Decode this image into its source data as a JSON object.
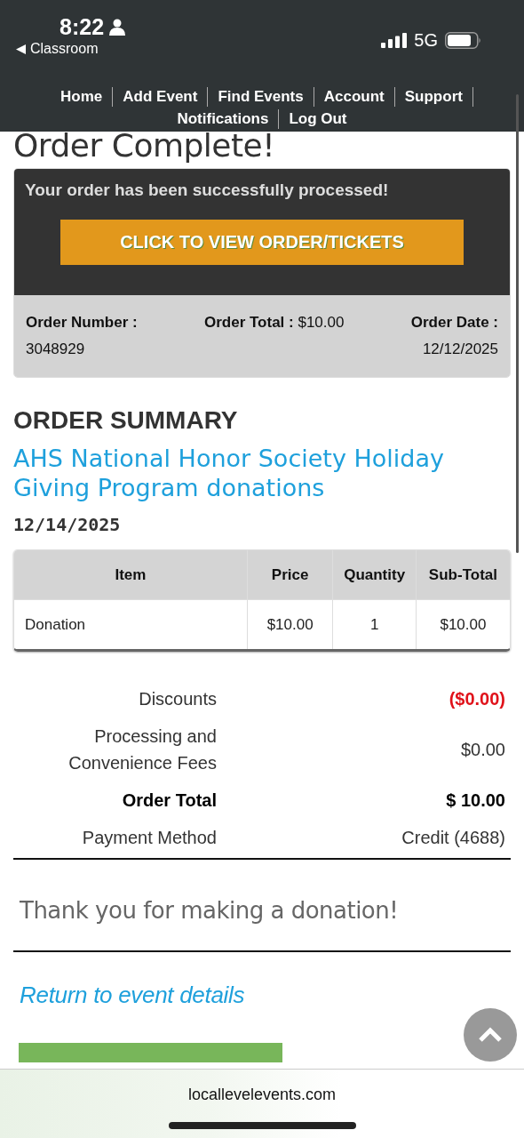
{
  "status_bar": {
    "time": "8:22",
    "back_label": "Classroom",
    "network": "5G"
  },
  "nav": {
    "items": [
      "Home",
      "Add Event",
      "Find Events",
      "Account",
      "Support",
      "Notifications",
      "Log Out"
    ]
  },
  "page": {
    "title": "Order Complete!"
  },
  "confirmation": {
    "message": "Your order has been successfully processed!",
    "button": "CLICK TO VIEW ORDER/TICKETS",
    "fields": [
      {
        "label": "Order Number :",
        "value": "3048929",
        "kind": "stacked"
      },
      {
        "label": "Order Total :",
        "value": "$10.00",
        "kind": "inline"
      },
      {
        "label": "Order Date :",
        "value": "12/12/2025",
        "kind": "stacked"
      }
    ]
  },
  "summary": {
    "heading": "ORDER SUMMARY",
    "event_title": "AHS National Honor Society Holiday Giving Program donations",
    "event_date": "12/14/2025",
    "table": {
      "columns": [
        "Item",
        "Price",
        "Quantity",
        "Sub-Total"
      ],
      "rows": [
        [
          "Donation",
          "$10.00",
          "1",
          "$10.00"
        ]
      ]
    },
    "totals": [
      {
        "label": "Discounts",
        "value": "($0.00)",
        "kind": "discount"
      },
      {
        "label": "Processing and Convenience Fees",
        "value": "$0.00",
        "kind": "plain"
      },
      {
        "label": "Order Total",
        "value": "$ 10.00",
        "kind": "total"
      },
      {
        "label": "Payment Method",
        "value": "Credit (4688)",
        "kind": "plain"
      }
    ],
    "thank_you": "Thank you for making a donation!",
    "return_link": "Return to event details"
  },
  "browser": {
    "url": "locallevelevents.com"
  }
}
